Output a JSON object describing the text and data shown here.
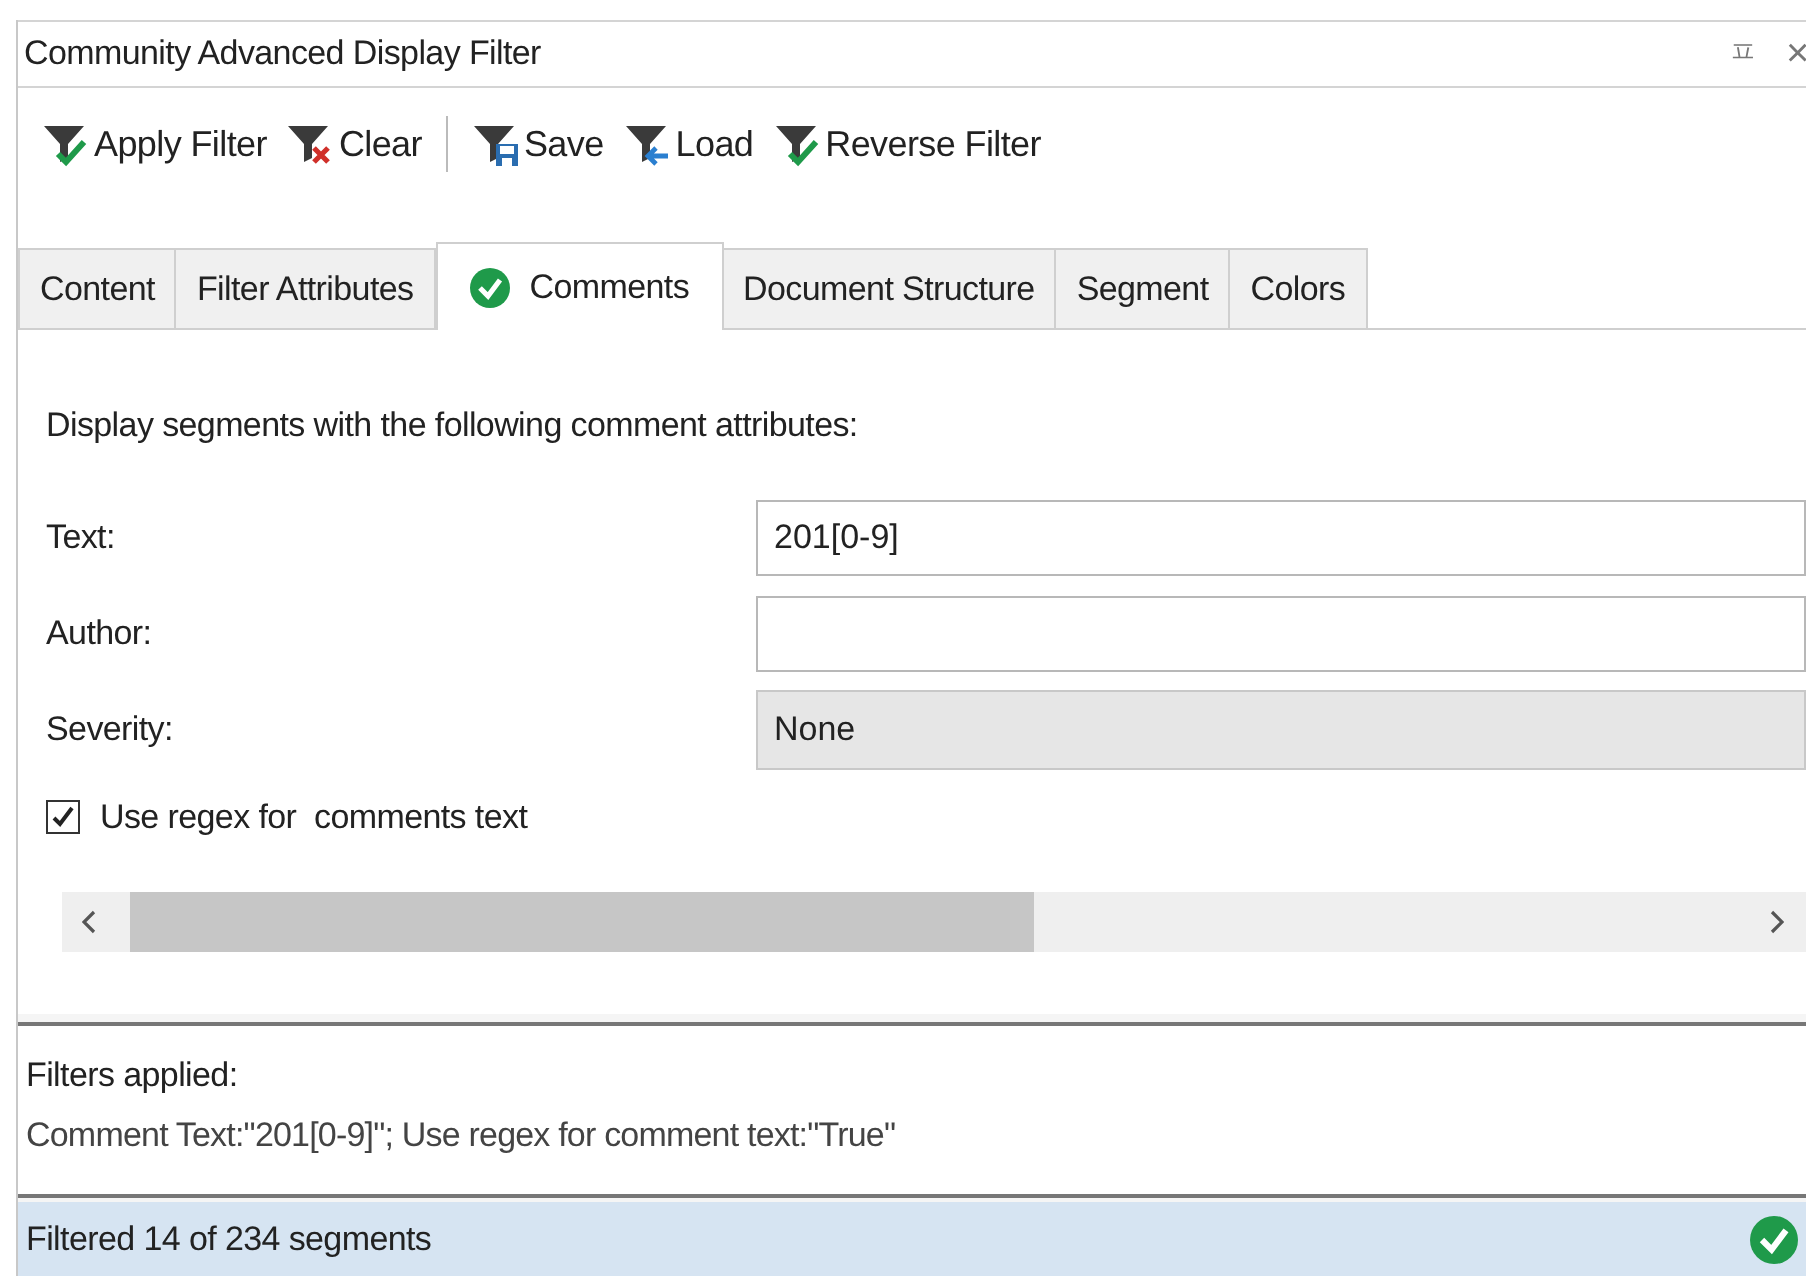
{
  "window": {
    "title": "Community Advanced Display Filter",
    "controls": [
      "ㅍ",
      "×"
    ]
  },
  "toolbar": [
    {
      "label": "Apply Filter",
      "kind": "apply"
    },
    {
      "label": "Clear",
      "kind": "clear"
    },
    {
      "label": "Save",
      "kind": "save"
    },
    {
      "label": "Load",
      "kind": "load"
    },
    {
      "label": "Reverse Filter",
      "kind": "apply"
    }
  ],
  "tabs": [
    {
      "label": "Content",
      "selected": false,
      "active": false
    },
    {
      "label": "Filter Attributes",
      "selected": false,
      "active": false
    },
    {
      "label": "Comments",
      "selected": true,
      "active": true
    },
    {
      "label": "Document Structure",
      "selected": false,
      "active": false
    },
    {
      "label": "Segment",
      "selected": false,
      "active": false
    },
    {
      "label": "Colors",
      "selected": false,
      "active": false
    }
  ],
  "intro": "Display segments with the following comment attributes:",
  "fields": [
    {
      "label": "Text:",
      "kind": "text",
      "value": "201[0-9]"
    },
    {
      "label": "Author:",
      "kind": "text"
    },
    {
      "label": "Severity:",
      "kind": "select",
      "value": "None"
    }
  ],
  "checkbox": {
    "label": "Use regex for  comments text",
    "checked": true
  },
  "filters_applied": {
    "heading": "Filters applied:",
    "text": "Comment Text:\"201[0-9]\"; Use regex for comment text:\"True\""
  },
  "status_bar": {
    "text": "Filtered 14 of 234 segments",
    "ok": true
  }
}
